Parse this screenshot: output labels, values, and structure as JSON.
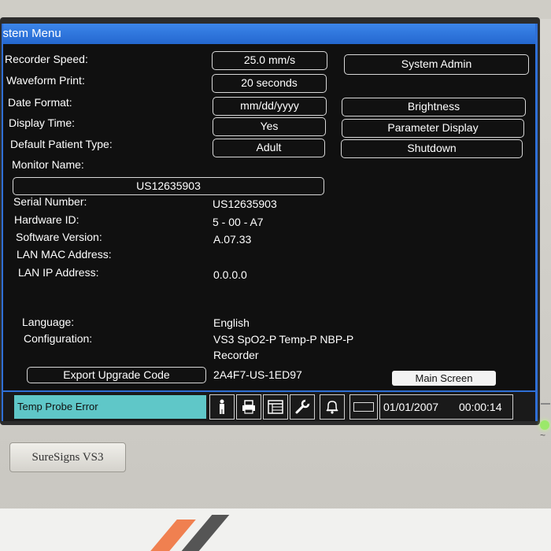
{
  "window": {
    "title": "ystem Menu"
  },
  "settings": [
    {
      "label": "Recorder Speed:",
      "value": "25.0 mm/s"
    },
    {
      "label": "Waveform Print:",
      "value": "20 seconds"
    },
    {
      "label": "Date Format:",
      "value": "mm/dd/yyyy"
    },
    {
      "label": "Display Time:",
      "value": "Yes"
    },
    {
      "label": "Default Patient Type:",
      "value": "Adult"
    }
  ],
  "side_buttons": {
    "system_admin": "System Admin",
    "brightness": "Brightness",
    "parameter_display": "Parameter Display",
    "shutdown": "Shutdown"
  },
  "monitor_name": {
    "label": "Monitor Name:",
    "value": "US12635903"
  },
  "info": [
    {
      "label": "Serial Number:",
      "value": "US12635903"
    },
    {
      "label": "Hardware ID:",
      "value": "5 - 00 - A7"
    },
    {
      "label": "Software Version:",
      "value": "A.07.33"
    },
    {
      "label": "LAN MAC Address:",
      "value": ""
    },
    {
      "label": "LAN IP Address:",
      "value": "0.0.0.0"
    }
  ],
  "language": {
    "label": "Language:",
    "value": "English"
  },
  "configuration": {
    "label": "Configuration:",
    "line1": "VS3 SpO2-P Temp-P NBP-P",
    "line2": "Recorder"
  },
  "upgrade": {
    "button": "Export Upgrade Code",
    "code": "2A4F7-US-1ED97"
  },
  "main_screen_button": "Main Screen",
  "status": {
    "alarm_message": "Temp Probe Error",
    "date": "01/01/2007",
    "time": "00:00:14",
    "icons": [
      "patient-icon",
      "printer-icon",
      "trend-table-icon",
      "wrench-icon",
      "alarm-bell-icon",
      "battery-icon"
    ]
  },
  "device": {
    "brand": "SureSigns VS3"
  },
  "colors": {
    "title_bar": "#2a6fd8",
    "alarm_bg": "#5fc7c8",
    "screen_bg": "#101010"
  }
}
